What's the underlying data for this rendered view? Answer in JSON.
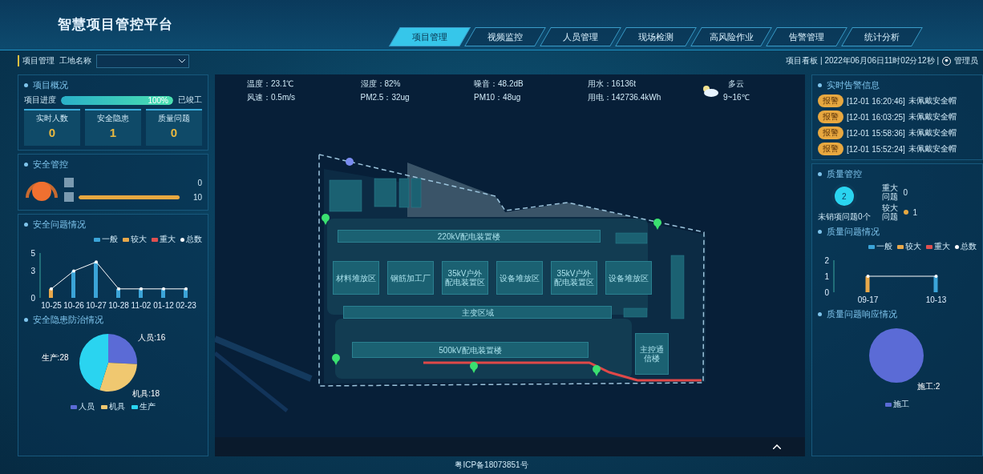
{
  "header": {
    "title": "智慧项目管控平台",
    "tabs": [
      {
        "label": "项目管理",
        "selected": true
      },
      {
        "label": "视频监控",
        "selected": false
      },
      {
        "label": "人员管理",
        "selected": false
      },
      {
        "label": "现场检测",
        "selected": false
      },
      {
        "label": "高风险作业",
        "selected": false
      },
      {
        "label": "告警管理",
        "selected": false
      },
      {
        "label": "统计分析",
        "selected": false
      }
    ]
  },
  "subbar": {
    "section": "项目管理",
    "site_label": "工地名称",
    "info": "项目看板 | 2022年06月06日11时02分12秒 |",
    "user": "管理员"
  },
  "left": {
    "overview": {
      "title": "项目概况",
      "progress_label": "项目进度",
      "progress": {
        "level": 1,
        "reading": "100%"
      },
      "status": "已竣工",
      "cards": [
        {
          "label": "实时人数",
          "value": "0"
        },
        {
          "label": "安全隐患",
          "value": "1"
        },
        {
          "label": "质量问题",
          "value": "0"
        }
      ]
    },
    "safety": {
      "title": "安全管控",
      "rows": [
        {
          "reading": "0"
        },
        {
          "reading": "10"
        }
      ]
    },
    "safety_issues": {
      "title": "安全问题情况",
      "chart_data": {
        "type": "bar",
        "categories": [
          "10-25",
          "10-26",
          "10-27",
          "10-28",
          "11-02",
          "01-12",
          "02-23"
        ],
        "ylim": [
          0,
          5
        ],
        "yticks": [
          0,
          3,
          5
        ],
        "series": [
          {
            "name": "一般",
            "color": "#3ba4d8",
            "values": [
              0,
              3,
              4,
              1,
              1,
              1,
              1
            ]
          },
          {
            "name": "较大",
            "color": "#e8a84a",
            "values": [
              1,
              0,
              0,
              0,
              0,
              0,
              0
            ]
          },
          {
            "name": "重大",
            "color": "#e05050",
            "values": [
              0,
              0,
              0,
              0,
              0,
              0,
              0
            ]
          },
          {
            "name": "总数",
            "color": "#ffffff",
            "type": "line",
            "values": [
              1,
              3,
              4,
              1,
              1,
              1,
              1
            ]
          }
        ]
      }
    },
    "hazards": {
      "title": "安全隐患防治情况",
      "chart_data": {
        "type": "pie",
        "categories": [
          "人员",
          "机具",
          "生产"
        ],
        "values": [
          16,
          18,
          28
        ],
        "colors": [
          "#5b6bd6",
          "#f0c870",
          "#2ad4f0"
        ],
        "value_labels": [
          "人员:16",
          "机具:18",
          "生产:28"
        ]
      }
    }
  },
  "weather": [
    {
      "label": "温度：23.1℃",
      "label2": "风速：0.5m/s"
    },
    {
      "label": "湿度：82%",
      "label2": "PM2.5：32ug"
    },
    {
      "label": "噪音：48.2dB",
      "label2": "PM10：48ug"
    },
    {
      "label": "用水：16136t",
      "label2": "用电：142736.4kWh"
    }
  ],
  "forecast": {
    "condition": "多云",
    "range": "9~16℃"
  },
  "map": {
    "zones": [
      "220kV配电装置楼",
      "材料堆放区",
      "钢筋加工厂",
      "35kV户外配电装置区",
      "设备堆放区",
      "35kV户外配电装置区",
      "设备堆放区",
      "主变区域",
      "500kV配电装置楼",
      "主控通信楼"
    ]
  },
  "right": {
    "alarms": {
      "title": "实时告警信息",
      "rows": [
        {
          "badge": "报警",
          "time": "[12-01 16:20:46]",
          "message": "未佩戴安全帽"
        },
        {
          "badge": "报警",
          "time": "[12-01 16:03:25]",
          "message": "未佩戴安全帽"
        },
        {
          "badge": "报警",
          "time": "[12-01 15:58:36]",
          "message": "未佩戴安全帽"
        },
        {
          "badge": "报警",
          "time": "[12-01 15:52:24]",
          "message": "未佩戴安全帽"
        }
      ]
    },
    "quality": {
      "title": "质量管控",
      "count": "2",
      "caption": "未销项问题0个",
      "rows": [
        {
          "label": "重大问题",
          "value": "0",
          "dot": false
        },
        {
          "label": "较大问题",
          "value": "1",
          "dot": true
        }
      ]
    },
    "quality_issues": {
      "title": "质量问题情况",
      "chart_data": {
        "type": "bar",
        "categories": [
          "09-17",
          "10-13"
        ],
        "ylim": [
          0,
          2
        ],
        "yticks": [
          0,
          1,
          2
        ],
        "series": [
          {
            "name": "一般",
            "color": "#3ba4d8",
            "values": [
              0,
              1
            ]
          },
          {
            "name": "较大",
            "color": "#e8a84a",
            "values": [
              1,
              0
            ]
          },
          {
            "name": "重大",
            "color": "#e05050",
            "values": [
              0,
              0
            ]
          },
          {
            "name": "总数",
            "color": "#ffffff",
            "type": "line",
            "values": [
              1,
              1
            ]
          }
        ]
      }
    },
    "response": {
      "title": "质量问题响应情况",
      "chart_data": {
        "type": "pie",
        "categories": [
          "施工"
        ],
        "colors": [
          "#5b6bd6"
        ],
        "value_labels": [
          "施工:2"
        ]
      }
    }
  },
  "footer": "粤ICP备18073851号"
}
